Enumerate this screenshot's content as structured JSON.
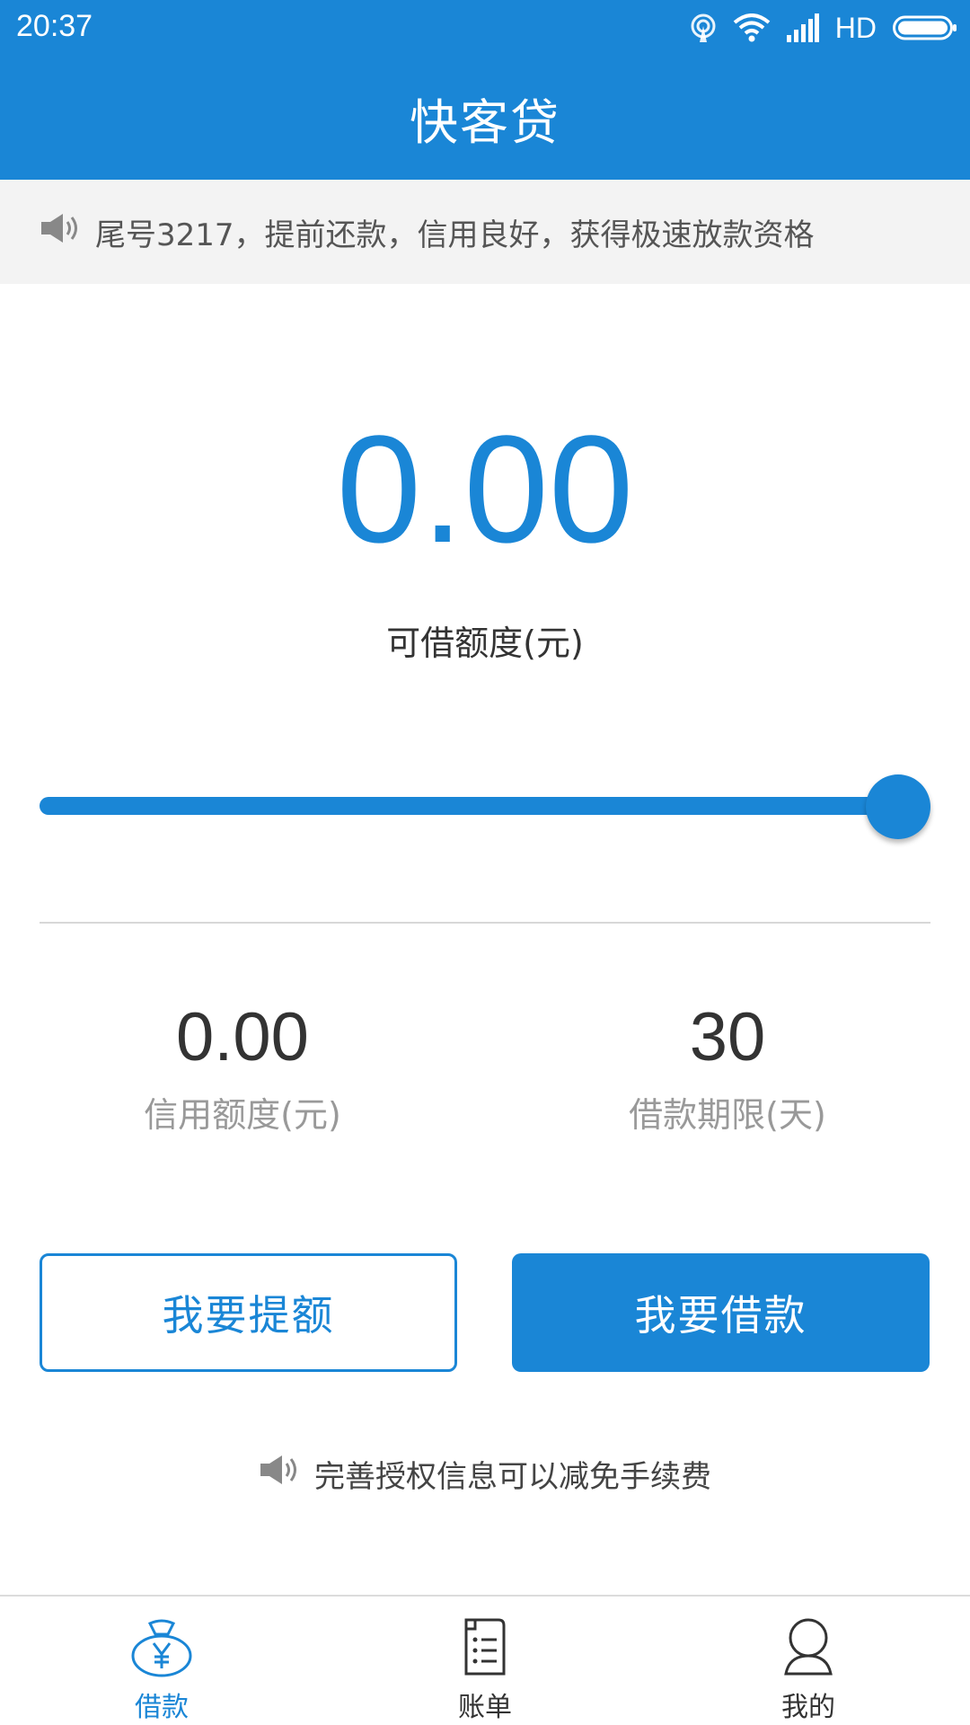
{
  "status_bar": {
    "time": "20:37",
    "network_label": "HD",
    "icons": [
      "hotspot-icon",
      "wifi-icon",
      "signal-icon",
      "battery-icon"
    ]
  },
  "header": {
    "title": "快客贷"
  },
  "notice": {
    "icon": "speaker-icon",
    "text": "尾号3217，提前还款，信用良好，获得极速放款资格"
  },
  "amount": {
    "value": "0.00",
    "label": "可借额度(元)"
  },
  "slider": {
    "level": 1.0
  },
  "stats": {
    "credit_value": "0.00",
    "credit_label": "信用额度(元)",
    "term_value": "30",
    "term_label": "借款期限(天)"
  },
  "buttons": {
    "raise_limit": "我要提额",
    "borrow": "我要借款"
  },
  "tip": {
    "icon": "speaker-icon",
    "text": "完善授权信息可以减免手续费"
  },
  "bottom_nav": {
    "items": [
      {
        "label": "借款",
        "icon": "money-bag-icon",
        "active": true
      },
      {
        "label": "账单",
        "icon": "bill-icon",
        "active": false
      },
      {
        "label": "我的",
        "icon": "user-icon",
        "active": false
      }
    ]
  },
  "colors": {
    "primary": "#1A86D6",
    "notice_bg": "#F3F3F3",
    "text_dark": "#333333",
    "text_muted": "#999999"
  }
}
